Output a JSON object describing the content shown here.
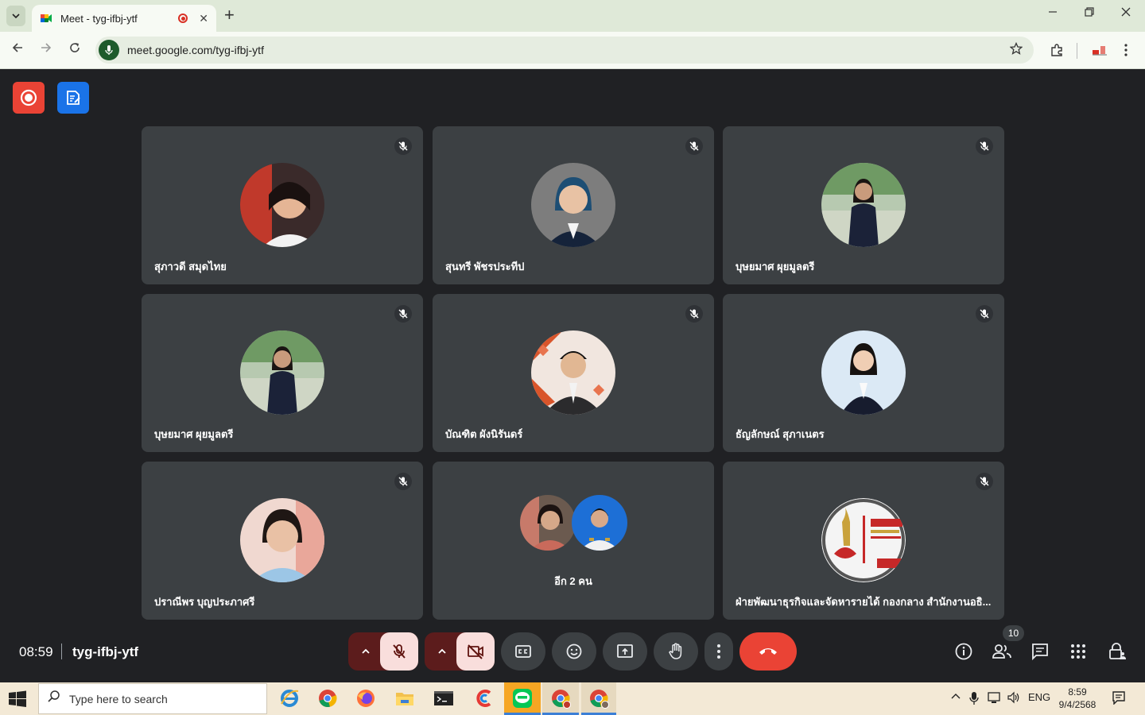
{
  "browser": {
    "tab_title": "Meet - tyg-ifbj-ytf",
    "url": "meet.google.com/tyg-ifbj-ytf",
    "new_tab_label": "+",
    "close_label": "✕"
  },
  "participants": [
    {
      "name": "สุภาวดี สมุดไทย"
    },
    {
      "name": "สุนทรี พัชรประทีป"
    },
    {
      "name": "บุษยมาศ ผุยมูลตรี"
    },
    {
      "name": "บุษยมาศ ผุยมูลตรี"
    },
    {
      "name": "บัณฑิต ผังนิรันดร์"
    },
    {
      "name": "ธัญลักษณ์ สุภาเนตร"
    },
    {
      "name": "ปราณีพร บุญประภาศรี"
    },
    {
      "name": "อีก 2 คน"
    },
    {
      "name": "ฝ่ายพัฒนาธุรกิจและจัดหารายได้ กองกลาง สำนักงานอธิ..."
    }
  ],
  "meeting": {
    "time": "08:59",
    "code": "tyg-ifbj-ytf",
    "people_count": "10"
  },
  "taskbar": {
    "search_placeholder": "Type here to search",
    "language": "ENG",
    "clock_time": "8:59",
    "clock_date": "9/4/2568"
  },
  "colors": {
    "background": "#202124",
    "tile": "#3c4043",
    "end_call": "#ea4335",
    "muted_button": "#f9dedc"
  }
}
